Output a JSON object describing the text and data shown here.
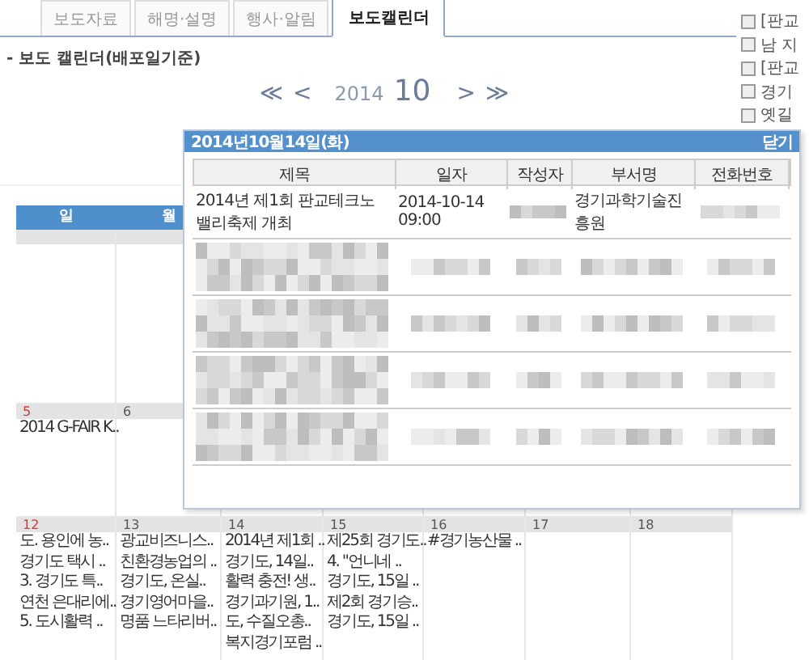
{
  "tabs": [
    {
      "label": "보도자료",
      "selected": false
    },
    {
      "label": "해명·설명",
      "selected": false
    },
    {
      "label": "행사·알림",
      "selected": false
    },
    {
      "label": "보도캘린더",
      "selected": true
    }
  ],
  "subtitle": "- 보도 캘린더(배포일기준)",
  "month_nav": {
    "first": "≪",
    "prev": "<",
    "year": "2014",
    "month": "10",
    "next": ">",
    "last": "≫"
  },
  "sidebar": {
    "items": [
      {
        "label": "[판교"
      },
      {
        "label": "남 지"
      },
      {
        "label": "[판교"
      },
      {
        "label": "경기"
      },
      {
        "label": "옛길"
      }
    ]
  },
  "calendar": {
    "weekdays": [
      "일",
      "월"
    ],
    "weeks": [
      {
        "kind": "blank"
      },
      {
        "days": [
          {
            "date": "5",
            "events": [
              "2014 G-FAIR K.."
            ]
          },
          {
            "date": "6"
          }
        ]
      },
      {
        "days": [
          {
            "date": "12",
            "events": [
              "도. 용인에 농..",
              "경기도 택시 ..",
              "3. 경기도 특..",
              "연천 은대리에..",
              "5. 도시활력 .."
            ]
          },
          {
            "date": "13",
            "events": [
              "광교비즈니스..",
              "친환경농업의 ..",
              "경기도, 온실..",
              "경기영어마을..",
              "명품 느타리버.."
            ]
          },
          {
            "date": "14",
            "events": [
              "2014년 제1회 ..",
              "경기도, 14일..",
              "활력 충전! 생..",
              "경기과기원, 1..",
              "도, 수질오총..",
              "복지경기포럼 .."
            ]
          },
          {
            "date": "15",
            "events": [
              "제25회 경기도..",
              "4. \"언니네 ..",
              "경기도, 15일 ..",
              "제2회 경기승..",
              "경기도, 15일 .."
            ]
          },
          {
            "date": "16",
            "events": [
              "#경기농산물 .."
            ]
          },
          {
            "date": "17"
          },
          {
            "date": "18"
          }
        ]
      }
    ]
  },
  "popup": {
    "title": "2014년10월14일(화)",
    "close": "닫기",
    "columns": [
      "제목",
      "일자",
      "작성자",
      "부서명",
      "전화번호"
    ],
    "rows": [
      {
        "kind": "text",
        "title": "2014년 제1회 판교테크노밸리축제 개최",
        "date": "2014-10-14 09:00",
        "department": "경기과학기술진흥원"
      },
      {
        "kind": "blurred"
      },
      {
        "kind": "blurred"
      },
      {
        "kind": "blurred"
      },
      {
        "kind": "blurred"
      }
    ]
  }
}
